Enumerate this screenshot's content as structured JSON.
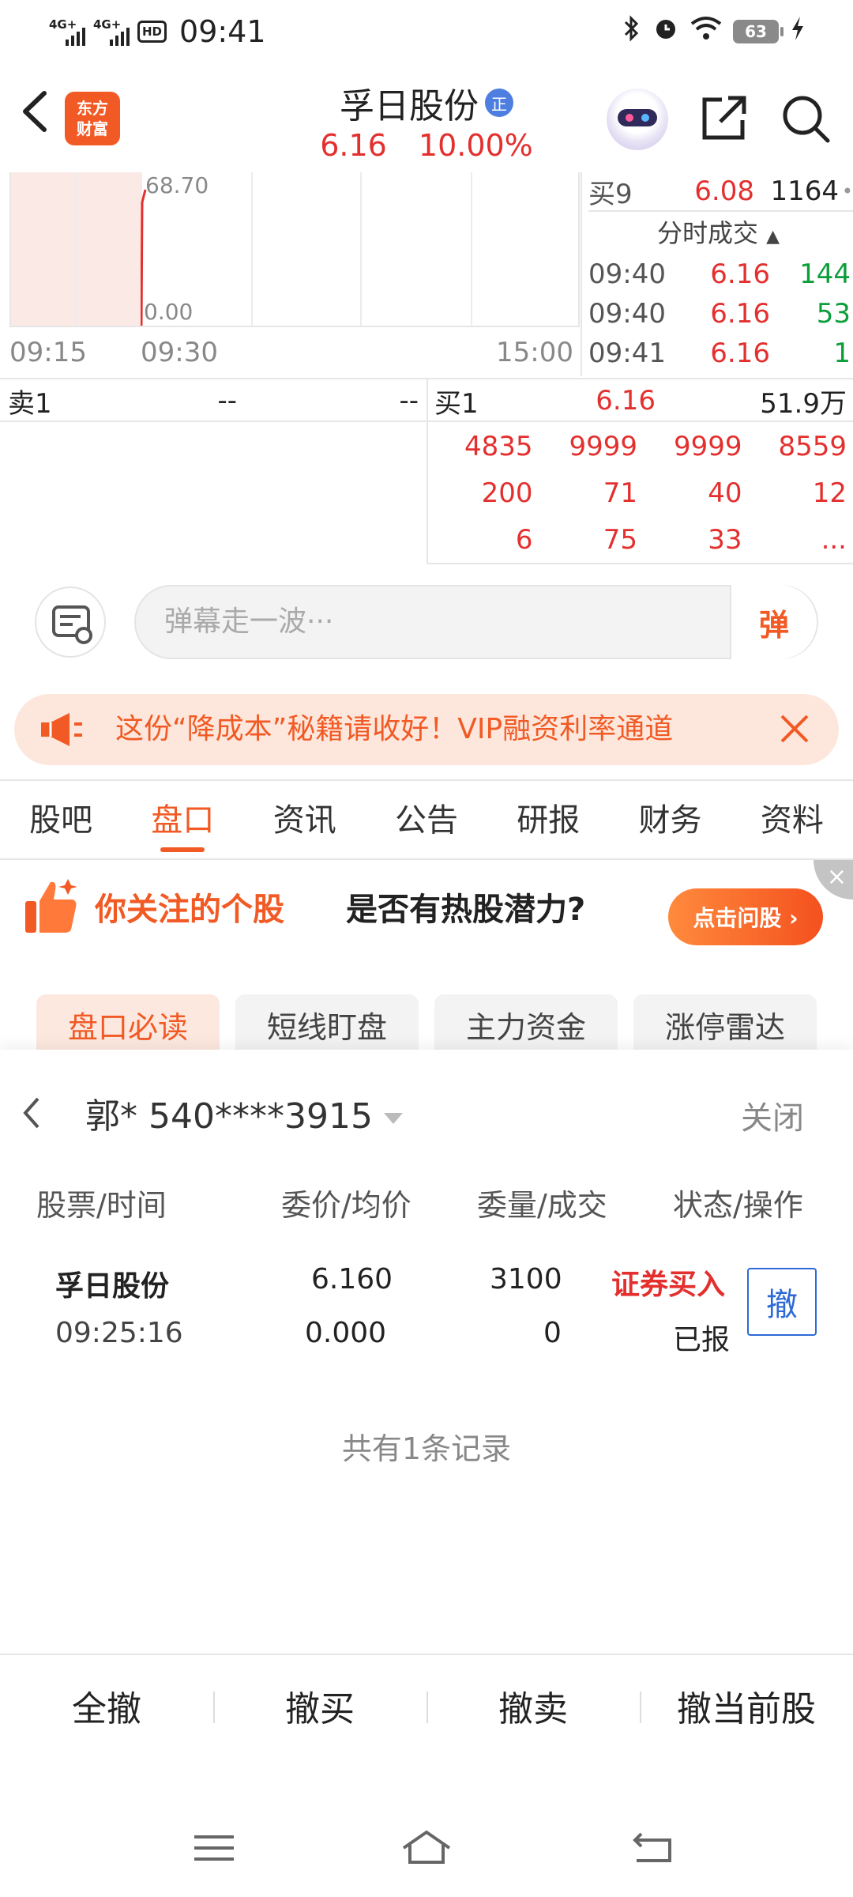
{
  "status_bar": {
    "net1": "4G+",
    "net2": "4G+",
    "hd": "HD",
    "time": "09:41",
    "battery": "63",
    "icons": [
      "bluetooth-icon",
      "alarm-icon",
      "wifi-icon",
      "battery-icon",
      "charging-icon"
    ]
  },
  "header": {
    "logo_line1": "东方",
    "logo_line2": "财富",
    "stock_name": "孚日股份",
    "badge": "正",
    "price": "6.16",
    "change_pct": "10.00%"
  },
  "chart": {
    "high_label": "68.70",
    "low_label": "0.00",
    "time_labels": [
      "09:15",
      "09:30",
      "15:00"
    ]
  },
  "order_book": {
    "buy9": {
      "label": "买9",
      "price": "6.08",
      "volume": "1164"
    },
    "ticks_title": "分时成交",
    "ticks": [
      {
        "time": "09:40",
        "price": "6.16",
        "volume": "144"
      },
      {
        "time": "09:40",
        "price": "6.16",
        "volume": "53"
      },
      {
        "time": "09:41",
        "price": "6.16",
        "volume": "1"
      }
    ],
    "sell1": {
      "label": "卖1",
      "price": "--",
      "volume": "--"
    },
    "buy1": {
      "label": "买1",
      "price": "6.16",
      "volume": "51.9万"
    },
    "queue": [
      "4835",
      "9999",
      "9999",
      "8559",
      "200",
      "71",
      "40",
      "12",
      "6",
      "75",
      "33",
      "..."
    ]
  },
  "danmu": {
    "placeholder": "弹幕走一波···",
    "send_label": "弹"
  },
  "promo": {
    "text": "这份“降成本”秘籍请收好！VIP融资利率通道"
  },
  "tabs": [
    "股吧",
    "盘口",
    "资讯",
    "公告",
    "研报",
    "财务",
    "资料"
  ],
  "active_tab": "盘口",
  "hot_banner": {
    "title": "你关注的个股",
    "subtitle": "是否有热股潜力?",
    "button": "点击问股 ›"
  },
  "chips": [
    "盘口必读",
    "短线盯盘",
    "主力资金",
    "涨停雷达"
  ],
  "orders_sheet": {
    "account": "郭* 540****3915",
    "close_label": "关闭",
    "headers": [
      "股票/时间",
      "委价/均价",
      "委量/成交",
      "状态/操作"
    ],
    "rows": [
      {
        "name": "孚日股份",
        "time": "09:25:16",
        "order_price": "6.160",
        "avg_price": "0.000",
        "order_qty": "3100",
        "filled_qty": "0",
        "type": "证券买入",
        "status": "已报",
        "action": "撤"
      }
    ],
    "record_count": "共有1条记录",
    "actions": [
      "全撤",
      "撤买",
      "撤卖",
      "撤当前股"
    ]
  },
  "colors": {
    "accent": "#f15a24",
    "up": "#e3302f",
    "down": "#0d9e3b",
    "link": "#2d6ad6"
  }
}
